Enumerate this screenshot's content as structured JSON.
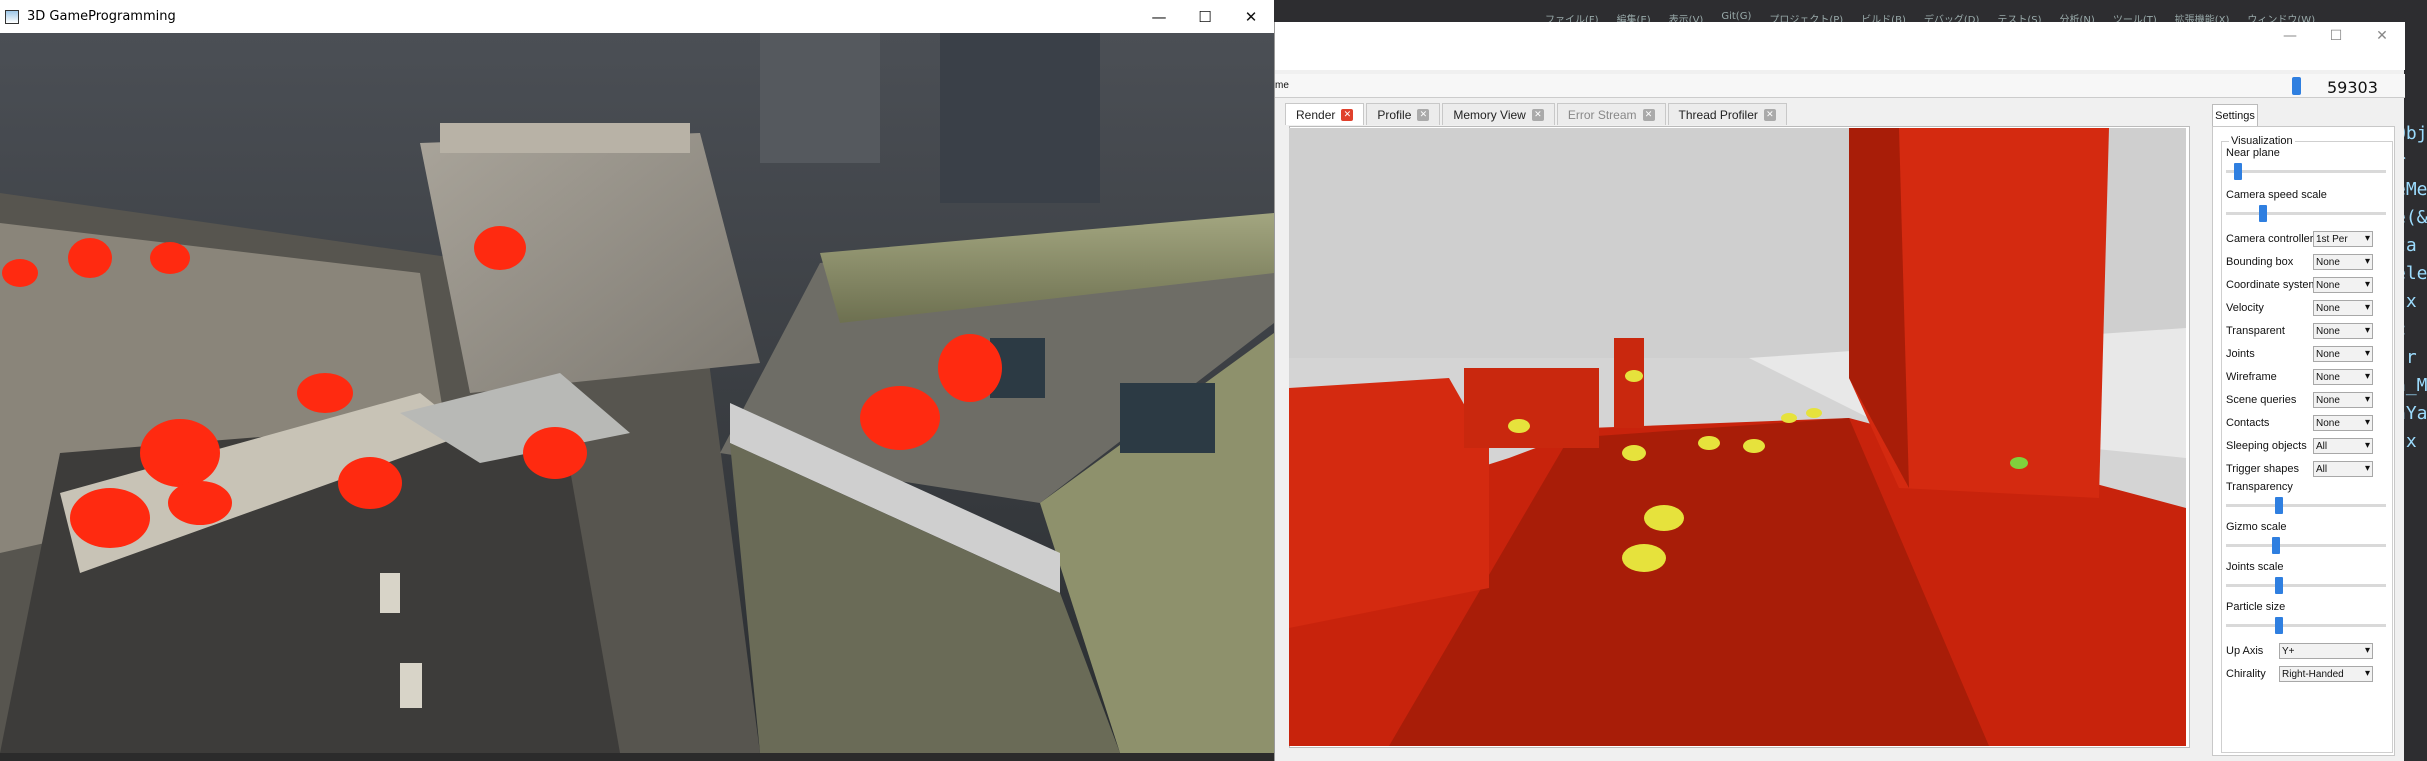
{
  "game_window": {
    "title": "3D GameProgramming",
    "controls": {
      "minimize": "—",
      "maximize": "☐",
      "close": "✕"
    }
  },
  "pvd": {
    "frame_number": "59303",
    "timeline_label": "me",
    "tabs": [
      {
        "label": "Render",
        "state": "active"
      },
      {
        "label": "Profile",
        "state": "normal"
      },
      {
        "label": "Memory View",
        "state": "normal"
      },
      {
        "label": "Error Stream",
        "state": "disabled"
      },
      {
        "label": "Thread Profiler",
        "state": "normal"
      }
    ],
    "settings": {
      "tab_label": "Settings",
      "group_label": "Visualization",
      "sliders": [
        {
          "label": "Near plane",
          "value": 0.05
        },
        {
          "label": "Camera speed scale",
          "value": 0.22
        },
        {
          "label": "Transparency",
          "value": 0.32
        },
        {
          "label": "Gizmo scale",
          "value": 0.3
        },
        {
          "label": "Joints scale",
          "value": 0.32
        },
        {
          "label": "Particle size",
          "value": 0.32
        }
      ],
      "dropdowns": [
        {
          "label": "Camera controller",
          "value": "1st Per"
        },
        {
          "label": "Bounding box",
          "value": "None"
        },
        {
          "label": "Coordinate system",
          "value": "None"
        },
        {
          "label": "Velocity",
          "value": "None"
        },
        {
          "label": "Transparent",
          "value": "None"
        },
        {
          "label": "Joints",
          "value": "None"
        },
        {
          "label": "Wireframe",
          "value": "None"
        },
        {
          "label": "Scene queries",
          "value": "None"
        },
        {
          "label": "Contacts",
          "value": "None"
        },
        {
          "label": "Sleeping objects",
          "value": "All"
        },
        {
          "label": "Trigger shapes",
          "value": "All"
        }
      ],
      "axis": [
        {
          "label": "Up Axis",
          "value": "Y+"
        },
        {
          "label": "Chirality",
          "value": "Right-Handed"
        }
      ]
    }
  },
  "ide_back": {
    "menu": [
      "ファイル(F)",
      "編集(E)",
      "表示(V)",
      "Git(G)",
      "プロジェクト(P)",
      "ビルド(B)",
      "デバッグ(D)",
      "テスト(S)",
      "分析(N)",
      "ツール(T)",
      "拡張機能(X)",
      "ウィンドウ(W)"
    ],
    "code_fragments": [
      "Obje",
      "r",
      "eMe",
      "e(&",
      "ta",
      "ele",
      "(x",
      "c",
      "'r",
      "n_M",
      "nYa",
      "(x"
    ]
  },
  "colors": {
    "accent_blue": "#2f7fe0",
    "pvd_red": "#d42a10",
    "enemy_red": "#ff2a10",
    "trigger_yellow": "#e6e23c"
  }
}
